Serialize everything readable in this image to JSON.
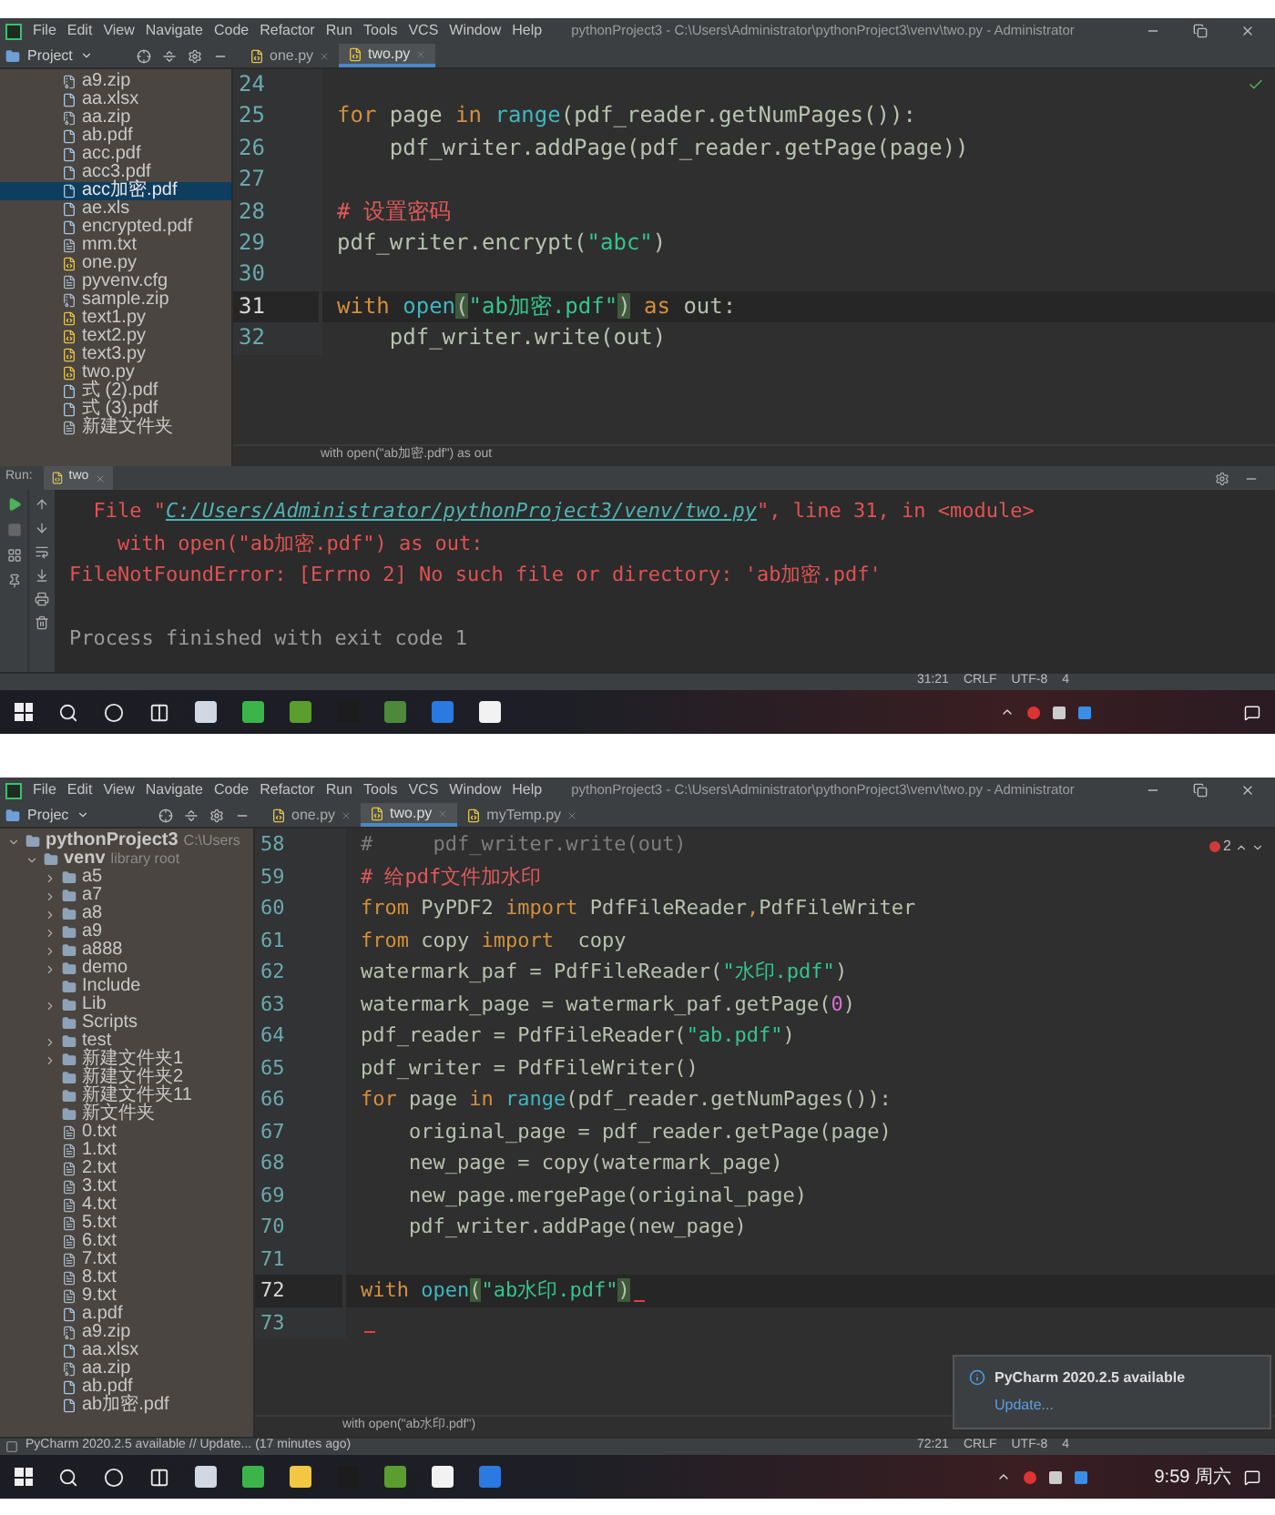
{
  "screens": [
    {
      "window": {
        "menu": [
          "File",
          "Edit",
          "View",
          "Navigate",
          "Code",
          "Refactor",
          "Run",
          "Tools",
          "VCS",
          "Window",
          "Help"
        ],
        "title": "pythonProject3 - C:\\Users\\Administrator\\pythonProject3\\venv\\two.py - Administrator"
      },
      "project_panel": {
        "label": "Project",
        "items": [
          {
            "label": "a9.zip",
            "kind": "zip",
            "selected": false
          },
          {
            "label": "aa.xlsx",
            "kind": "doc",
            "selected": false
          },
          {
            "label": "aa.zip",
            "kind": "zip",
            "selected": false
          },
          {
            "label": "ab.pdf",
            "kind": "doc",
            "selected": false
          },
          {
            "label": "acc.pdf",
            "kind": "doc",
            "selected": false
          },
          {
            "label": "acc3.pdf",
            "kind": "doc",
            "selected": false
          },
          {
            "label": "acc加密.pdf",
            "kind": "doc",
            "selected": true
          },
          {
            "label": "ae.xls",
            "kind": "doc",
            "selected": false
          },
          {
            "label": "encrypted.pdf",
            "kind": "doc",
            "selected": false
          },
          {
            "label": "mm.txt",
            "kind": "txt",
            "selected": false
          },
          {
            "label": "one.py",
            "kind": "py",
            "selected": false
          },
          {
            "label": "pyvenv.cfg",
            "kind": "txt",
            "selected": false
          },
          {
            "label": "sample.zip",
            "kind": "zip",
            "selected": false
          },
          {
            "label": "text1.py",
            "kind": "py",
            "selected": false
          },
          {
            "label": "text2.py",
            "kind": "py",
            "selected": false
          },
          {
            "label": "text3.py",
            "kind": "py",
            "selected": false
          },
          {
            "label": "two.py",
            "kind": "py",
            "selected": false
          },
          {
            "label": "式 (2).pdf",
            "kind": "doc",
            "selected": false
          },
          {
            "label": "式 (3).pdf",
            "kind": "doc",
            "selected": false
          },
          {
            "label": "新建文件夹",
            "kind": "txt",
            "selected": false
          }
        ]
      },
      "tabs": [
        {
          "label": "one.py",
          "selected": false
        },
        {
          "label": "two.py",
          "selected": true
        }
      ],
      "editor": {
        "inspection": {
          "kind": "ok"
        },
        "lines": [
          {
            "number": "24",
            "current": false
          },
          {
            "number": "25",
            "current": false,
            "tokens": [
              {
                "kind": "keyword",
                "text": "for"
              },
              {
                "kind": "plain",
                "text": " page "
              },
              {
                "kind": "keyword",
                "text": "in"
              },
              {
                "kind": "builtin",
                "text": " range"
              },
              {
                "kind": "plain",
                "text": "(pdf_reader.getNumPages()):"
              }
            ]
          },
          {
            "number": "26",
            "current": false,
            "tokens": [
              {
                "kind": "plain",
                "text": "    pdf_writer.addPage(pdf_reader.getPage(page))"
              }
            ]
          },
          {
            "number": "27",
            "current": false
          },
          {
            "number": "28",
            "current": false,
            "tokens": [
              {
                "kind": "comment",
                "text": "# 设置密码"
              }
            ]
          },
          {
            "number": "29",
            "current": false,
            "tokens": [
              {
                "kind": "plain",
                "text": "pdf_writer.encrypt("
              },
              {
                "kind": "string",
                "text": "\"abc\""
              },
              {
                "kind": "plain",
                "text": ")"
              }
            ]
          },
          {
            "number": "30",
            "current": false
          },
          {
            "number": "31",
            "current": true,
            "tokens": [
              {
                "kind": "keyword",
                "text": "with"
              },
              {
                "kind": "builtin",
                "text": " open"
              },
              {
                "kind": "brace",
                "text": "("
              },
              {
                "kind": "string",
                "text": "\"ab加密.pdf\""
              },
              {
                "kind": "brace",
                "text": ")"
              },
              {
                "kind": "keyword",
                "text": " as"
              },
              {
                "kind": "plain",
                "text": " out:"
              }
            ]
          },
          {
            "number": "32",
            "current": false,
            "tokens": [
              {
                "kind": "plain",
                "text": "    pdf_writer.write(out)"
              }
            ]
          }
        ],
        "breadcrumb": "with open(\"ab加密.pdf\") as out"
      },
      "run": {
        "label": "Run:",
        "tab": "two",
        "output": [
          {
            "kind": "trace",
            "tokens": [
              {
                "kind": "error",
                "text": "  File \""
              },
              {
                "kind": "link",
                "text": "C:/Users/Administrator/pythonProject3/venv/two.py"
              },
              {
                "kind": "error",
                "text": "\", line 31, in <module>"
              }
            ]
          },
          {
            "kind": "trace",
            "tokens": [
              {
                "kind": "error",
                "text": "    with open(\"ab加密.pdf\") as out:"
              }
            ]
          },
          {
            "kind": "trace",
            "tokens": [
              {
                "kind": "error",
                "text": "FileNotFoundError: [Errno 2] No such file or directory: 'ab加密.pdf'"
              }
            ]
          },
          {
            "kind": "result",
            "tokens": [
              {
                "kind": "normal",
                "text": "Process finished with exit code 1"
              }
            ]
          }
        ]
      },
      "status_bar": {
        "items": [
          "31:21",
          "CRLF",
          "UTF-8",
          "4"
        ]
      }
    },
    {
      "window": {
        "menu": [
          "File",
          "Edit",
          "View",
          "Navigate",
          "Code",
          "Refactor",
          "Run",
          "Tools",
          "VCS",
          "Window",
          "Help"
        ],
        "title": "pythonProject3 - C:\\Users\\Administrator\\pythonProject3\\venv\\two.py - Administrator"
      },
      "project_panel": {
        "label": "Projec",
        "items": [
          {
            "label": "pythonProject3",
            "hint": "C:\\Users",
            "kind": "folder",
            "expanded": true,
            "selected": false,
            "children": [
              {
                "label": "venv",
                "hint": "library root",
                "kind": "folder",
                "expanded": true,
                "selected": false,
                "children": [
                  {
                    "label": "a5",
                    "kind": "folder",
                    "expanded": false,
                    "selected": false
                  },
                  {
                    "label": "a7",
                    "kind": "folder",
                    "expanded": false,
                    "selected": false
                  },
                  {
                    "label": "a8",
                    "kind": "folder",
                    "expanded": false,
                    "selected": false
                  },
                  {
                    "label": "a9",
                    "kind": "folder",
                    "expanded": false,
                    "selected": false
                  },
                  {
                    "label": "a888",
                    "kind": "folder",
                    "expanded": false,
                    "selected": false
                  },
                  {
                    "label": "demo",
                    "kind": "folder",
                    "expanded": false,
                    "selected": false
                  },
                  {
                    "label": "Include",
                    "kind": "folder",
                    "selected": false
                  },
                  {
                    "label": "Lib",
                    "kind": "folder",
                    "expanded": false,
                    "selected": false
                  },
                  {
                    "label": "Scripts",
                    "kind": "folder",
                    "selected": false
                  },
                  {
                    "label": "test",
                    "kind": "folder",
                    "expanded": false,
                    "selected": false
                  },
                  {
                    "label": "新建文件夹1",
                    "kind": "folder",
                    "expanded": false,
                    "selected": false
                  },
                  {
                    "label": "新建文件夹2",
                    "kind": "folder",
                    "selected": false
                  },
                  {
                    "label": "新建文件夹11",
                    "kind": "folder",
                    "selected": false
                  },
                  {
                    "label": "新文件夹",
                    "kind": "folder",
                    "selected": false
                  },
                  {
                    "label": "0.txt",
                    "kind": "txt",
                    "selected": false
                  },
                  {
                    "label": "1.txt",
                    "kind": "txt",
                    "selected": false
                  },
                  {
                    "label": "2.txt",
                    "kind": "txt",
                    "selected": false
                  },
                  {
                    "label": "3.txt",
                    "kind": "txt",
                    "selected": false
                  },
                  {
                    "label": "4.txt",
                    "kind": "txt",
                    "selected": false
                  },
                  {
                    "label": "5.txt",
                    "kind": "txt",
                    "selected": false
                  },
                  {
                    "label": "6.txt",
                    "kind": "txt",
                    "selected": false
                  },
                  {
                    "label": "7.txt",
                    "kind": "txt",
                    "selected": false
                  },
                  {
                    "label": "8.txt",
                    "kind": "txt",
                    "selected": false
                  },
                  {
                    "label": "9.txt",
                    "kind": "txt",
                    "selected": false
                  },
                  {
                    "label": "a.pdf",
                    "kind": "doc",
                    "selected": false
                  },
                  {
                    "label": "a9.zip",
                    "kind": "zip",
                    "selected": false
                  },
                  {
                    "label": "aa.xlsx",
                    "kind": "doc",
                    "selected": false
                  },
                  {
                    "label": "aa.zip",
                    "kind": "zip",
                    "selected": false
                  },
                  {
                    "label": "ab.pdf",
                    "kind": "doc",
                    "selected": false
                  },
                  {
                    "label": "ab加密.pdf",
                    "kind": "doc",
                    "selected": false
                  }
                ]
              }
            ]
          }
        ]
      },
      "tabs": [
        {
          "label": "one.py",
          "selected": false
        },
        {
          "label": "two.py",
          "selected": true
        },
        {
          "label": "myTemp.py",
          "selected": false
        }
      ],
      "editor": {
        "inspection": {
          "kind": "errors",
          "count": "2"
        },
        "lines": [
          {
            "number": "58",
            "current": false,
            "tokens": [
              {
                "kind": "disabled",
                "text": "#     pdf_writer.write(out)"
              }
            ]
          },
          {
            "number": "59",
            "current": false,
            "tokens": [
              {
                "kind": "comment",
                "text": "# 给pdf文件加水印"
              }
            ]
          },
          {
            "number": "60",
            "current": false,
            "tokens": [
              {
                "kind": "keyword",
                "text": "from"
              },
              {
                "kind": "plain",
                "text": " PyPDF2 "
              },
              {
                "kind": "keyword",
                "text": "import"
              },
              {
                "kind": "plain",
                "text": " PdfFileReader"
              },
              {
                "kind": "keyword",
                "text": ","
              },
              {
                "kind": "plain",
                "text": "PdfFileWriter"
              }
            ]
          },
          {
            "number": "61",
            "current": false,
            "tokens": [
              {
                "kind": "keyword",
                "text": "from"
              },
              {
                "kind": "plain",
                "text": " copy "
              },
              {
                "kind": "keyword",
                "text": "import"
              },
              {
                "kind": "plain",
                "text": "  copy"
              }
            ]
          },
          {
            "number": "62",
            "current": false,
            "tokens": [
              {
                "kind": "plain",
                "text": "watermark_paf = PdfFileReader("
              },
              {
                "kind": "string",
                "text": "\"水印.pdf\""
              },
              {
                "kind": "plain",
                "text": ")"
              }
            ]
          },
          {
            "number": "63",
            "current": false,
            "tokens": [
              {
                "kind": "plain",
                "text": "watermark_page = watermark_paf.getPage("
              },
              {
                "kind": "number",
                "text": "0"
              },
              {
                "kind": "plain",
                "text": ")"
              }
            ]
          },
          {
            "number": "64",
            "current": false,
            "tokens": [
              {
                "kind": "plain",
                "text": "pdf_reader = PdfFileReader("
              },
              {
                "kind": "string",
                "text": "\"ab.pdf\""
              },
              {
                "kind": "plain",
                "text": ")"
              }
            ]
          },
          {
            "number": "65",
            "current": false,
            "tokens": [
              {
                "kind": "plain",
                "text": "pdf_writer = PdfFileWriter()"
              }
            ]
          },
          {
            "number": "66",
            "current": false,
            "tokens": [
              {
                "kind": "keyword",
                "text": "for"
              },
              {
                "kind": "plain",
                "text": " page "
              },
              {
                "kind": "keyword",
                "text": "in"
              },
              {
                "kind": "builtin",
                "text": " range"
              },
              {
                "kind": "plain",
                "text": "(pdf_reader.getNumPages()):"
              }
            ]
          },
          {
            "number": "67",
            "current": false,
            "tokens": [
              {
                "kind": "plain",
                "text": "    original_page = pdf_reader.getPage(page)"
              }
            ]
          },
          {
            "number": "68",
            "current": false,
            "tokens": [
              {
                "kind": "plain",
                "text": "    new_page = copy(watermark_page)"
              }
            ]
          },
          {
            "number": "69",
            "current": false,
            "tokens": [
              {
                "kind": "plain",
                "text": "    new_page.mergePage(original_page)"
              }
            ]
          },
          {
            "number": "70",
            "current": false,
            "tokens": [
              {
                "kind": "plain",
                "text": "    pdf_writer.addPage(new_page)"
              }
            ]
          },
          {
            "number": "71",
            "current": false
          },
          {
            "number": "72",
            "current": true,
            "error_marker": true,
            "tokens": [
              {
                "kind": "keyword",
                "text": "with"
              },
              {
                "kind": "builtin",
                "text": " open"
              },
              {
                "kind": "brace",
                "text": "("
              },
              {
                "kind": "string",
                "text": "\"ab水印.pdf\""
              },
              {
                "kind": "brace",
                "text": ")"
              }
            ]
          },
          {
            "number": "73",
            "current": false,
            "error_marker": true
          }
        ],
        "breadcrumb": "with open(\"ab水印.pdf\")"
      },
      "notification": {
        "title": "PyCharm 2020.2.5 available",
        "link": "Update..."
      },
      "status_bar": {
        "message": "PyCharm 2020.2.5 available // Update... (17 minutes ago)",
        "items": [
          "72:21",
          "CRLF",
          "UTF-8",
          "4"
        ]
      },
      "taskbar": {
        "clock": "9:59 周六"
      }
    }
  ]
}
